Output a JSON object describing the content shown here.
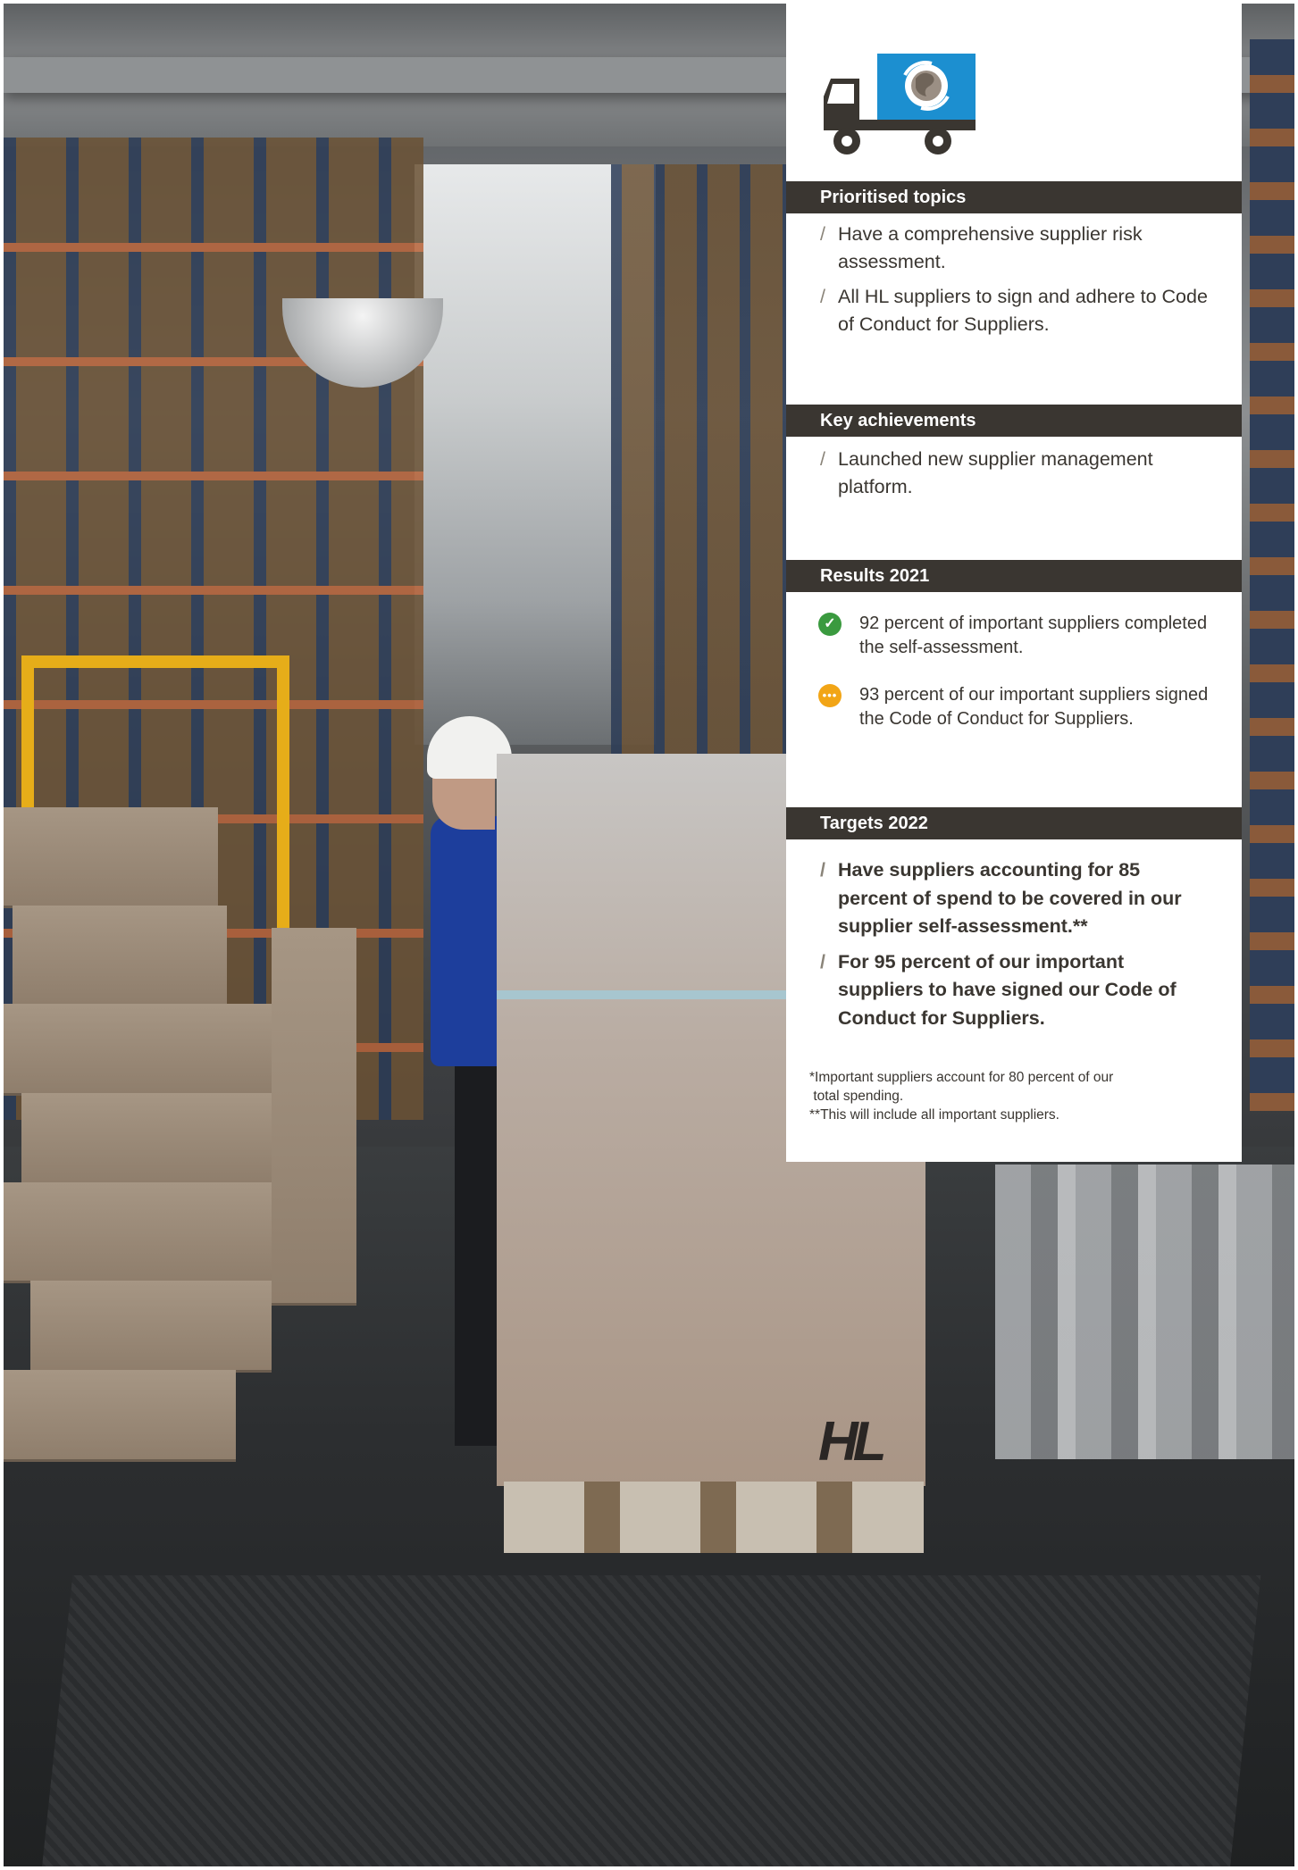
{
  "colors": {
    "section_bar": "#3a3631",
    "text": "#3a3631",
    "slash": "#8a8479",
    "status_done": "#3a9a3f",
    "status_in_progress": "#f2a516",
    "logo_blue": "#1c8fd0"
  },
  "photo": {
    "box_brand_mark": "HL"
  },
  "panel": {
    "logo_icon": "supplier-truck-globe-icon",
    "prioritised": {
      "heading": "Prioritised topics",
      "items": [
        "Have a comprehensive supplier risk assessment.",
        "All HL suppliers to sign and adhere to Code of Conduct for Suppliers."
      ]
    },
    "achievements": {
      "heading": "Key achievements",
      "items": [
        "Launched new supplier management platform."
      ]
    },
    "results": {
      "heading": "Results 2021",
      "items": [
        {
          "status": "done",
          "icon": "check-icon",
          "text": "92 percent of important suppliers completed the self-assessment."
        },
        {
          "status": "in-progress",
          "icon": "ellipsis-icon",
          "text": "93 percent of our important suppliers signed the Code of Conduct for Suppliers."
        }
      ]
    },
    "targets": {
      "heading": "Targets 2022",
      "items": [
        "Have suppliers accounting for 85 percent of spend to be covered in our supplier self-assessment.**",
        "For 95 percent of our important suppliers to have signed our Code of Conduct for Suppliers."
      ]
    },
    "footnotes": [
      "*Important suppliers account for 80 percent of our\n total spending.",
      "**This will include all important suppliers."
    ]
  }
}
